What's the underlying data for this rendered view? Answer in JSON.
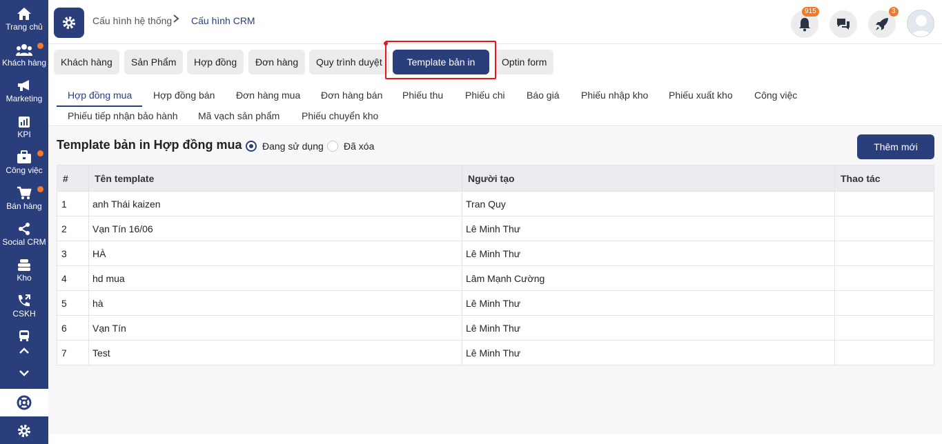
{
  "sidebar": {
    "items": [
      {
        "label": "Trang chủ",
        "icon": "home-icon"
      },
      {
        "label": "Khách hàng",
        "icon": "users-icon",
        "dot": true
      },
      {
        "label": "Marketing",
        "icon": "megaphone-icon"
      },
      {
        "label": "KPI",
        "icon": "bar-chart-icon"
      },
      {
        "label": "Công việc",
        "icon": "briefcase-icon",
        "dot": true
      },
      {
        "label": "Bán hàng",
        "icon": "cart-icon",
        "dot": true
      },
      {
        "label": "Social CRM",
        "icon": "share-icon"
      },
      {
        "label": "Kho",
        "icon": "stack-icon"
      },
      {
        "label": "CSKH",
        "icon": "phone-icon"
      }
    ],
    "extra_icons": [
      "bus-icon",
      "chevron-up-icon",
      "chevron-down-icon",
      "support-icon",
      "settings-icon"
    ],
    "dot_color": "#f07a2a",
    "bg_color": "#2a3e7c"
  },
  "header": {
    "breadcrumb": [
      "Cấu hình hệ thống",
      "Cấu hình CRM"
    ],
    "notifications": {
      "icon": "bell-icon",
      "badge": "915"
    },
    "chat": {
      "icon": "chat-icon"
    },
    "rocket": {
      "icon": "rocket-icon",
      "badge": "3"
    },
    "avatar": {
      "icon": "avatar-icon"
    }
  },
  "config_tabs": [
    {
      "label": "Khách hàng"
    },
    {
      "label": "Sản Phẩm"
    },
    {
      "label": "Hợp đồng"
    },
    {
      "label": "Đơn hàng"
    },
    {
      "label": "Quy trình duyệt"
    },
    {
      "label": "Template bản in",
      "active": true
    },
    {
      "label": "Optin form"
    }
  ],
  "sub_tabs": {
    "row1": [
      "Hợp đồng mua",
      "Hợp đồng bán",
      "Đơn hàng mua",
      "Đơn hàng bán",
      "Phiếu thu",
      "Phiếu chi",
      "Báo giá",
      "Phiếu nhập kho",
      "Phiếu xuất kho",
      "Công việc"
    ],
    "row2": [
      "Phiếu tiếp nhận bảo hành",
      "Mã vạch sản phẩm",
      "Phiếu chuyển kho"
    ],
    "active": "Hợp đồng mua"
  },
  "main": {
    "title": "Template bản in Hợp đồng mua",
    "filter": {
      "option_active": "Đang sử dụng",
      "option_deleted": "Đã xóa",
      "selected": "Đang sử dụng"
    },
    "add_button": "Thêm mới",
    "table": {
      "headers": [
        "#",
        "Tên template",
        "Người tạo",
        "Thao tác"
      ],
      "rows": [
        [
          "1",
          "anh Thái kaizen",
          "Tran Quy",
          ""
        ],
        [
          "2",
          "Vạn Tín 16/06",
          "Lê Minh Thư",
          ""
        ],
        [
          "3",
          "HÀ",
          "Lê Minh Thư",
          ""
        ],
        [
          "4",
          "hd mua",
          "Lâm Mạnh Cường",
          ""
        ],
        [
          "5",
          "hà",
          "Lê Minh Thư",
          ""
        ],
        [
          "6",
          "Vạn Tín",
          "Lê Minh Thư",
          ""
        ],
        [
          "7",
          "Test",
          "Lê Minh Thư",
          ""
        ]
      ]
    }
  },
  "colors": {
    "accent": "#2a3e7c",
    "badge": "#f07a2a",
    "highlight": "#e8161b"
  }
}
